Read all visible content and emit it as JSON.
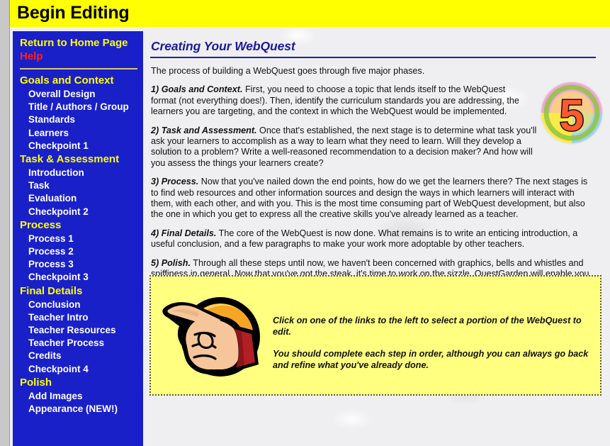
{
  "header": {
    "title": "Begin Editing"
  },
  "colors": {
    "header_bg": "#ffff00",
    "sidebar_bg": "#1a20c8",
    "sidebar_section": "#ffff00",
    "sidebar_item": "#ffffff",
    "help_link": "#ff2020",
    "heading": "#1a1a9c",
    "callout_bg": "#ffff80",
    "page_bg": "#efeff1"
  },
  "sidebar": {
    "home_label": "Return to Home Page",
    "help_label": "Help",
    "groups": [
      {
        "section": "Goals and Context",
        "items": [
          "Overall Design",
          "Title / Authors / Group",
          "Standards",
          "Learners",
          "Checkpoint 1"
        ]
      },
      {
        "section": "Task & Assessment",
        "items": [
          "Introduction",
          "Task",
          "Evaluation",
          "Checkpoint 2"
        ]
      },
      {
        "section": "Process",
        "items": [
          "Process 1",
          "Process 2",
          "Process 3",
          "Checkpoint 3"
        ]
      },
      {
        "section": "Final Details",
        "items": [
          "Conclusion",
          "Teacher Intro",
          "Teacher Resources",
          "Teacher Process",
          "Credits",
          "Checkpoint 4"
        ]
      },
      {
        "section": "Polish",
        "items": [
          "Add Images",
          "Appearance (NEW!)"
        ]
      }
    ]
  },
  "main": {
    "heading": "Creating Your WebQuest",
    "intro": "The process of building a WebQuest goes through five major phases.",
    "badge_number": "5",
    "phases": [
      {
        "label": "1) Goals and Context.",
        "text": " First, you need to choose a topic that lends itself to the WebQuest format (not everything does!). Then, identify the curriculum standards you are addressing, the learners you are targeting, and the context in which the WebQuest would be implemented."
      },
      {
        "label": "2) Task and Assessment.",
        "text": " Once that's established, the next stage is to determine what task you'll ask your learners to accomplish as a way to learn what they need to learn. Will they develop a solution to a problem? Write a well-reasoned recommendation to a decision maker? And how will you assess the things your learners create?"
      },
      {
        "label": "3) Process.",
        "text": " Now that you've nailed down the end points, how do we get the learners there? The next stages is to find web resources and other information sources and design the ways in which learners will interact with them, with each other, and with you. This is the most time consuming part of WebQuest development, but also the one in which you get to express all the creative skills you've already learned as a teacher."
      },
      {
        "label": "4) Final Details.",
        "text": " The core of the WebQuest is now done. What remains is to write an enticing introduction, a useful conclusion, and a few paragraphs to make your work more adoptable by other teachers."
      },
      {
        "label": "5) Polish.",
        "text": " Through all these steps until now, we haven't been concerned with graphics, bells and whistles and spiffiness in general. Now that you've got the steak, it's time to work on the sizzle. QuestGarden will enable you to publish an attractive version of your lesson without you needing to know anything about HTML, FTP and other geeky necessities."
      }
    ]
  },
  "callout": {
    "line1": "Click on one of the links to the left to select a portion of the WebQuest to edit.",
    "line2": "You should complete each step in order, although you can always go back and refine what you've already done."
  }
}
